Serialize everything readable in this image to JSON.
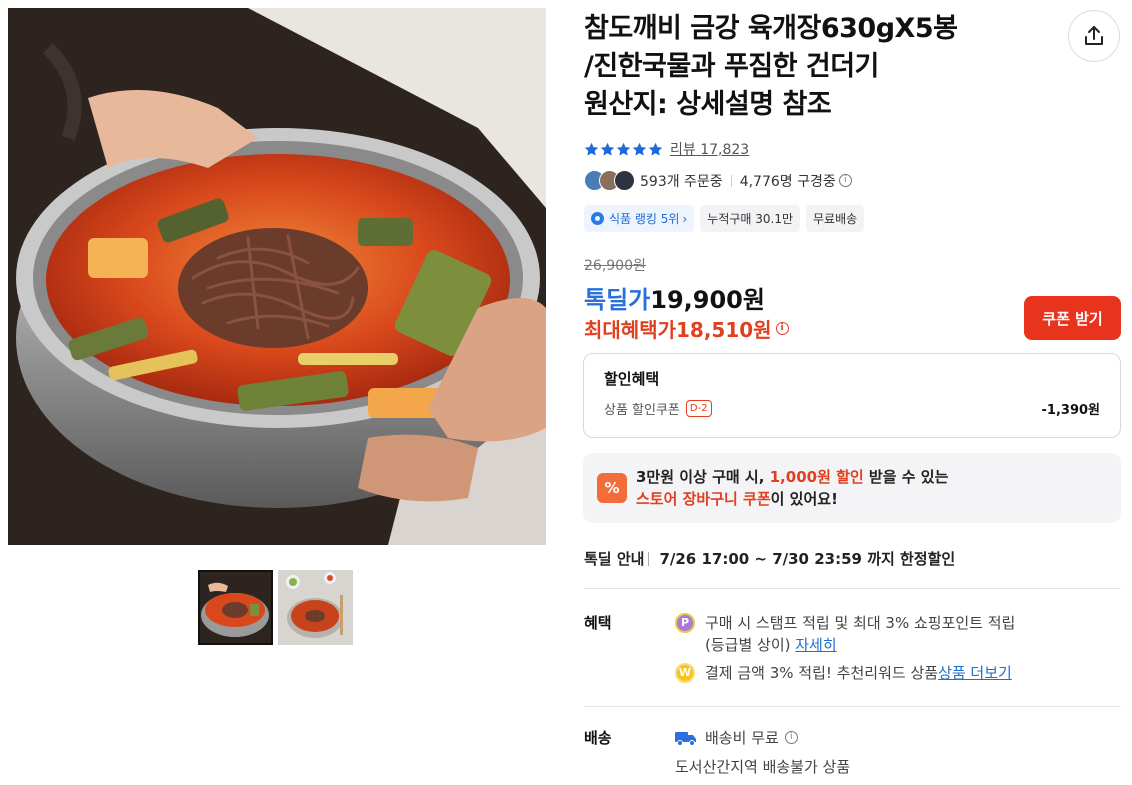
{
  "product": {
    "title_lines": [
      "참도깨비 금강 육개장630gX5봉",
      "/진한국물과 푸짐한 건더기",
      "원산지: 상세설명 참조"
    ],
    "rating_stars": 5,
    "review_label": "리뷰",
    "review_count": "17,823"
  },
  "social": {
    "orders": "593개 주문중",
    "viewers": "4,776명 구경중",
    "info_glyph": "i"
  },
  "tags": [
    {
      "label": "식품 랭킹 5위",
      "suffix": "›"
    },
    {
      "label": "누적구매 30.1만"
    },
    {
      "label": "무료배송"
    }
  ],
  "price": {
    "original": "26,900원",
    "deal_label": "톡딜가",
    "deal_value": "19,900원",
    "max_benefit_label": "최대혜택가",
    "max_benefit_value": "18,510원",
    "coupon_button": "쿠폰 받기"
  },
  "discount": {
    "title": "할인혜택",
    "coupon_label": "상품 할인쿠폰",
    "dday": "D-2",
    "amount": "-1,390원"
  },
  "cart_coupon": {
    "icon": "%",
    "line1_pre": "3만원 이상 구매 시, ",
    "line1_hl": "1,000원 할인",
    "line1_post": " 받을 수 있는",
    "line2_hl": "스토어 장바구니 쿠폰",
    "line2_post": "이 있어요!"
  },
  "deal_info": {
    "label": "톡딜 안내",
    "text": "7/26 17:00 ~ 7/30 23:59 까지 한정할인"
  },
  "benefits": {
    "label": "혜택",
    "item1_coin": "P",
    "item1_text": "구매 시 스탬프 적립 및 최대 3% 쇼핑포인트 적립",
    "item1_text2": "(등급별 상이) ",
    "item1_link": "자세히",
    "item2_coin": "W",
    "item2_text": "결제 금액 3% 적립! 추천리워드 상품 ",
    "item2_link": "상품 더보기"
  },
  "delivery": {
    "label": "배송",
    "fee": "배송비 무료",
    "note": "도서산간지역 배송불가 상품",
    "info_glyph": "i"
  },
  "colors": {
    "accent_blue": "#2a6fdb",
    "accent_red": "#e0401f",
    "coupon_button": "#e8341c",
    "star": "#1e6cd8"
  }
}
